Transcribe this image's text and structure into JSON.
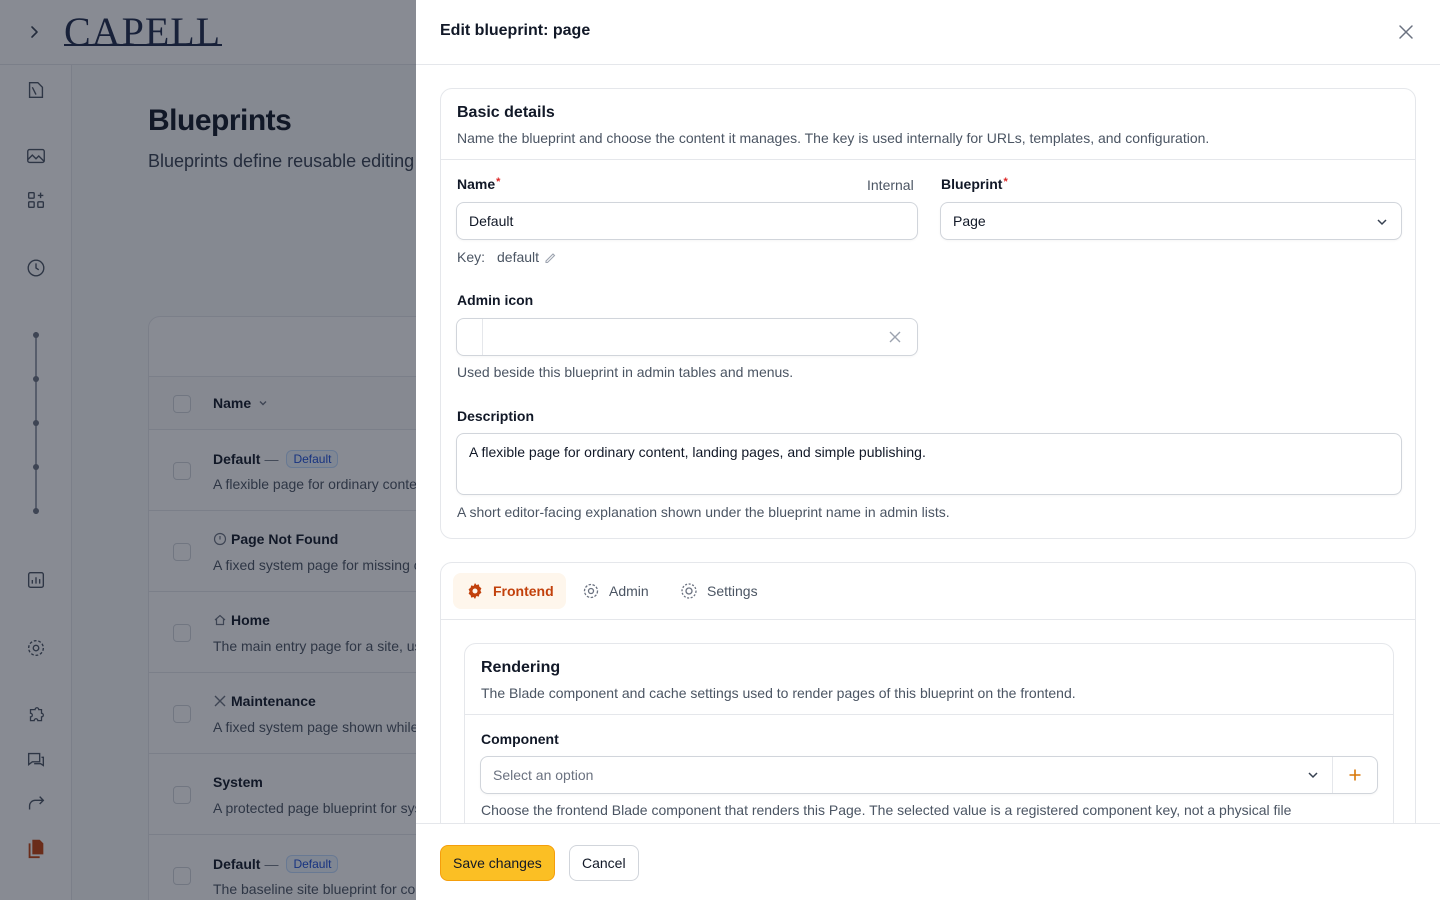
{
  "app": {
    "logo": "CAPELL",
    "page_title": "Blueprints",
    "page_subtitle": "Blueprints define reusable editing structures for content types.",
    "table": {
      "column_name": "Name",
      "rows": [
        {
          "title": "Default",
          "badge": "Default",
          "icon": "",
          "description": "A flexible page for ordinary content, landing pages, and simple publishing."
        },
        {
          "title": "Page Not Found",
          "badge": "",
          "icon": "info-circle-icon",
          "description": "A fixed system page for missing content."
        },
        {
          "title": "Home",
          "badge": "",
          "icon": "home-icon",
          "description": "The main entry page for a site, usually at the root URL."
        },
        {
          "title": "Maintenance",
          "badge": "",
          "icon": "tools-icon",
          "description": "A fixed system page shown while the site is in maintenance."
        },
        {
          "title": "System",
          "badge": "",
          "icon": "",
          "description": "A protected page blueprint for system content."
        },
        {
          "title": "Default",
          "badge": "Default",
          "icon": "",
          "description": "The baseline site blueprint for content and settings."
        }
      ]
    }
  },
  "drawer": {
    "title": "Edit blueprint: page",
    "basic": {
      "title": "Basic details",
      "description": "Name the blueprint and choose the content it manages. The key is used internally for URLs, templates, and configuration.",
      "name_label": "Name",
      "name_aside": "Internal",
      "name_value": "Default",
      "key_label": "Key:",
      "key_value": "default",
      "blueprint_label": "Blueprint",
      "blueprint_value": "Page",
      "icon_label": "Admin icon",
      "icon_value": "",
      "icon_hint": "Used beside this blueprint in admin tables and menus.",
      "description_label": "Description",
      "description_value": "A flexible page for ordinary content, landing pages, and simple publishing.",
      "description_hint": "A short editor-facing explanation shown under the blueprint name in admin lists."
    },
    "tabs": [
      {
        "label": "Frontend",
        "icon": "cog-solid-icon",
        "active": true
      },
      {
        "label": "Admin",
        "icon": "cog-outline-icon",
        "active": false
      },
      {
        "label": "Settings",
        "icon": "settings-icon",
        "active": false
      }
    ],
    "rendering": {
      "title": "Rendering",
      "description": "The Blade component and cache settings used to render pages of this blueprint on the frontend.",
      "component_label": "Component",
      "component_placeholder": "Select an option",
      "component_hint": "Choose the frontend Blade component that renders this Page. The selected value is a registered component key, not a physical file"
    },
    "footer": {
      "save_label": "Save changes",
      "cancel_label": "Cancel"
    }
  },
  "colors": {
    "accent": "#fbbf24",
    "accent_text": "#c2410c",
    "overlay": "rgba(17,24,39,0.5)"
  }
}
